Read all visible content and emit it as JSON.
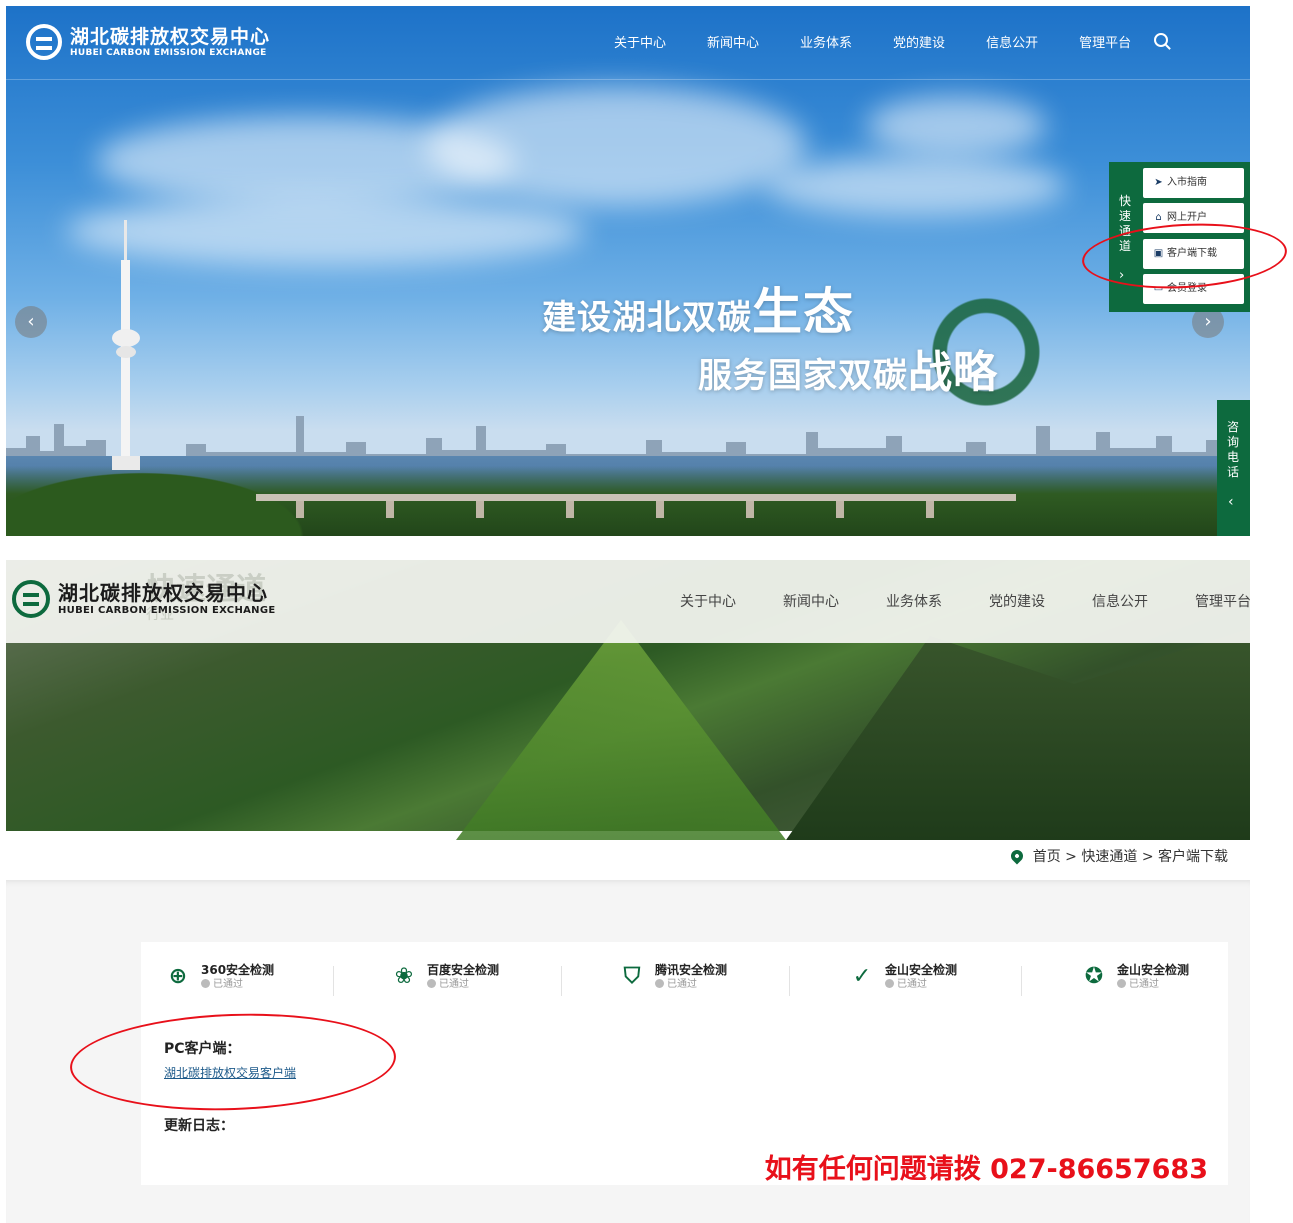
{
  "hero": {
    "logo": {
      "cn": "湖北碳排放权交易中心",
      "en": "HUBEI CARBON EMISSION EXCHANGE"
    },
    "menu": [
      "关于中心",
      "新闻中心",
      "业务体系",
      "党的建设",
      "信息公开",
      "管理平台"
    ],
    "slogan_line1": "建设湖北双碳",
    "slogan_line1_art": "生态",
    "slogan_line2": "服务国家双碳",
    "slogan_line2_art": "战略",
    "prev_arrow": "‹",
    "next_arrow": "›",
    "quick_channel": {
      "title": "快速通道",
      "toggle": "›",
      "items": [
        {
          "label": "入市指南",
          "icon": "paper-plane-icon",
          "glyph": "➤"
        },
        {
          "label": "网上开户",
          "icon": "bank-icon",
          "glyph": "⌂"
        },
        {
          "label": "客户端下载",
          "icon": "disk-icon",
          "glyph": "▣"
        },
        {
          "label": "会员登录",
          "icon": "monitor-icon",
          "glyph": "▭"
        }
      ]
    },
    "consult": {
      "title": "咨询电话",
      "toggle": "‹"
    }
  },
  "lower": {
    "logo": {
      "cn": "湖北碳排放权交易中心",
      "en": "HUBEI CARBON EMISSION EXCHANGE"
    },
    "ghost_title": "快速通道",
    "ghost_sub": "行业",
    "menu": [
      "关于中心",
      "新闻中心",
      "业务体系",
      "党的建设",
      "信息公开",
      "管理平台"
    ],
    "breadcrumb": "首页 > 快速通道 > 客户端下载",
    "security_checks": [
      {
        "name": "360安全检测",
        "status": "已通过",
        "icon": "plus-shield-icon",
        "glyph": "⊕"
      },
      {
        "name": "百度安全检测",
        "status": "已通过",
        "icon": "paw-icon",
        "glyph": "❀"
      },
      {
        "name": "腾讯安全检测",
        "status": "已通过",
        "icon": "shield-check-icon",
        "glyph": "⛉"
      },
      {
        "name": "金山安全检测",
        "status": "已通过",
        "icon": "check-arrow-icon",
        "glyph": "✓"
      },
      {
        "name": "金山安全检测",
        "status": "已通过",
        "icon": "lion-badge-icon",
        "glyph": "✪"
      }
    ],
    "pc_client_label": "PC客户端：",
    "pc_client_link": "湖北碳排放权交易客户端",
    "changelog_label": "更新日志：",
    "phone_note": "如有任何问题请拨 027-86657683"
  },
  "colors": {
    "brand_green": "#0d6a3e",
    "annotation_red": "#e8101a"
  }
}
